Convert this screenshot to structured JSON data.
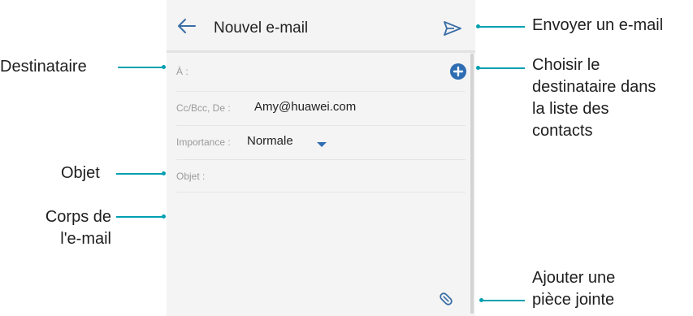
{
  "header": {
    "back_icon": "arrow-left-icon",
    "title": "Nouvel e-mail",
    "send_icon": "send-icon"
  },
  "fields": {
    "to_label": "À :",
    "cc_label": "Cc/Bcc, De :",
    "from_value": "Amy@huawei.com",
    "importance_label": "Importance :",
    "importance_value": "Normale",
    "subject_label": "Objet :"
  },
  "icons": {
    "add_contact": "plus-circle-icon",
    "dropdown": "caret-down-icon",
    "attach": "paperclip-icon"
  },
  "callouts": {
    "destinataire": "Destinataire",
    "objet": "Objet",
    "corps_line1": "Corps de",
    "corps_line2": "l'e-mail",
    "envoyer": "Envoyer un e-mail",
    "choisir_line1": "Choisir le",
    "choisir_line2": "destinataire dans",
    "choisir_line3": "la liste des",
    "choisir_line4": "contacts",
    "ajouter_line1": "Ajouter une",
    "ajouter_line2": "pièce jointe"
  },
  "colors": {
    "accent": "#3a6ea5",
    "callout": "#00a0b0"
  }
}
